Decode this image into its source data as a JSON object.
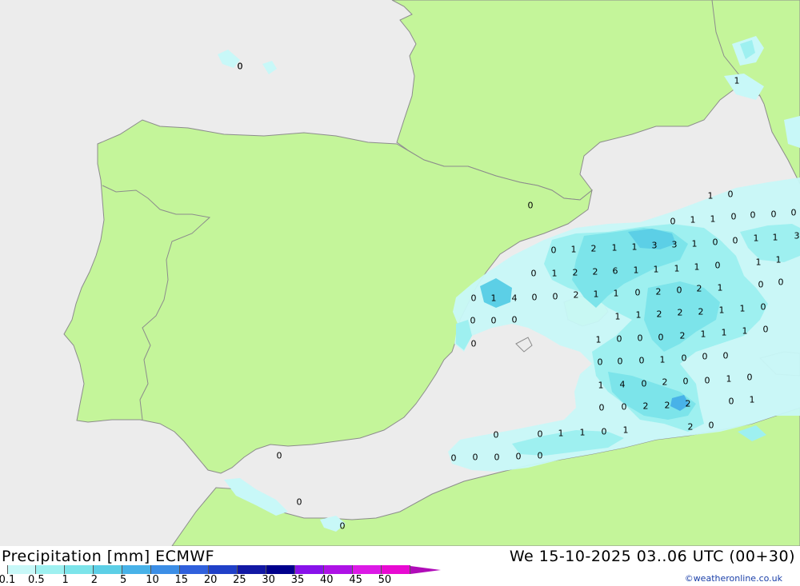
{
  "header": {
    "title": "Precipitation [mm] ECMWF",
    "datetime": "We 15-10-2025 03..06 UTC (00+30)"
  },
  "colors": {
    "sea": "#ececec",
    "land": "#c4f59a",
    "border": "#8c8c8c"
  },
  "legend": {
    "ticks": [
      "0.1",
      "0.5",
      "1",
      "2",
      "5",
      "10",
      "15",
      "20",
      "25",
      "30",
      "35",
      "40",
      "45",
      "50"
    ],
    "colors": [
      "#c8f8f8",
      "#9ef0f0",
      "#7ce4ea",
      "#5ccfe6",
      "#48b2e8",
      "#3c8ee6",
      "#3060dc",
      "#2040c8",
      "#1218a4",
      "#00008c",
      "#8812ea",
      "#ae12e6",
      "#dc1ae6",
      "#e80ad2",
      "#b00cb8"
    ]
  },
  "credit": "©weatheronline.co.uk",
  "precip_values": [
    {
      "v": "0"
    },
    {
      "v": "0"
    },
    {
      "v": "1"
    },
    {
      "v": "0"
    },
    {
      "v": "1"
    },
    {
      "v": "0"
    },
    {
      "v": "0"
    },
    {
      "v": "1"
    },
    {
      "v": "1"
    },
    {
      "v": "0"
    },
    {
      "v": "0"
    },
    {
      "v": "0"
    },
    {
      "v": "0"
    },
    {
      "v": "0"
    },
    {
      "v": "1"
    },
    {
      "v": "2"
    },
    {
      "v": "1"
    },
    {
      "v": "1"
    },
    {
      "v": "3"
    },
    {
      "v": "3"
    },
    {
      "v": "1"
    },
    {
      "v": "0"
    },
    {
      "v": "0"
    },
    {
      "v": "1"
    },
    {
      "v": "1"
    },
    {
      "v": "3"
    },
    {
      "v": "1"
    },
    {
      "v": "1"
    },
    {
      "v": "0"
    },
    {
      "v": "1"
    },
    {
      "v": "2"
    },
    {
      "v": "2"
    },
    {
      "v": "6"
    },
    {
      "v": "1"
    },
    {
      "v": "1"
    },
    {
      "v": "1"
    },
    {
      "v": "1"
    },
    {
      "v": "0"
    },
    {
      "v": "0"
    },
    {
      "v": "1"
    },
    {
      "v": "4"
    },
    {
      "v": "0"
    },
    {
      "v": "0"
    },
    {
      "v": "2"
    },
    {
      "v": "1"
    },
    {
      "v": "1"
    },
    {
      "v": "0"
    },
    {
      "v": "2"
    },
    {
      "v": "0"
    },
    {
      "v": "2"
    },
    {
      "v": "1"
    },
    {
      "v": "0"
    },
    {
      "v": "0"
    },
    {
      "v": "1"
    },
    {
      "v": "1"
    },
    {
      "v": "2"
    },
    {
      "v": "2"
    },
    {
      "v": "2"
    },
    {
      "v": "1"
    },
    {
      "v": "1"
    },
    {
      "v": "0"
    },
    {
      "v": "0"
    },
    {
      "v": "0"
    },
    {
      "v": "0"
    },
    {
      "v": "1"
    },
    {
      "v": "0"
    },
    {
      "v": "0"
    },
    {
      "v": "0"
    },
    {
      "v": "2"
    },
    {
      "v": "1"
    },
    {
      "v": "1"
    },
    {
      "v": "1"
    },
    {
      "v": "0"
    },
    {
      "v": "0"
    },
    {
      "v": "0"
    },
    {
      "v": "0"
    },
    {
      "v": "0"
    },
    {
      "v": "1"
    },
    {
      "v": "0"
    },
    {
      "v": "0"
    },
    {
      "v": "0"
    },
    {
      "v": "1"
    },
    {
      "v": "4"
    },
    {
      "v": "0"
    },
    {
      "v": "2"
    },
    {
      "v": "0"
    },
    {
      "v": "0"
    },
    {
      "v": "1"
    },
    {
      "v": "0"
    },
    {
      "v": "0"
    },
    {
      "v": "1"
    },
    {
      "v": "0"
    },
    {
      "v": "0"
    },
    {
      "v": "2"
    },
    {
      "v": "2"
    },
    {
      "v": "2"
    },
    {
      "v": "2"
    },
    {
      "v": "0"
    },
    {
      "v": "0"
    },
    {
      "v": "0"
    },
    {
      "v": "1"
    },
    {
      "v": "1"
    },
    {
      "v": "0"
    },
    {
      "v": "1"
    },
    {
      "v": "0"
    },
    {
      "v": "0"
    },
    {
      "v": "0"
    },
    {
      "v": "0"
    },
    {
      "v": "0"
    },
    {
      "v": "0"
    },
    {
      "v": "0"
    },
    {
      "v": "0"
    }
  ]
}
